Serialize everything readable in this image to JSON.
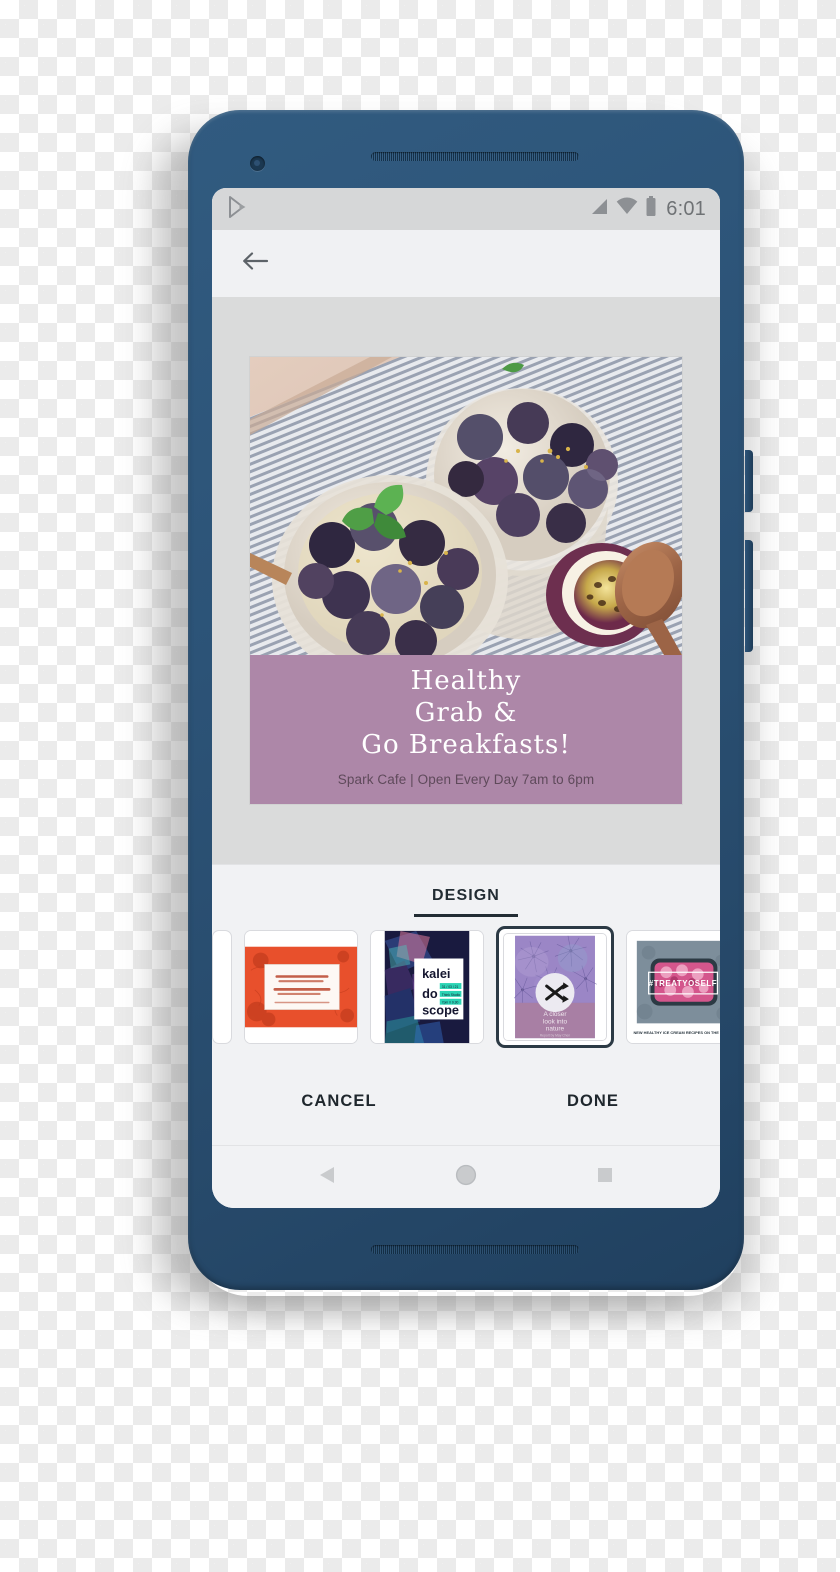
{
  "status_bar": {
    "app_icon": "play-store-icon",
    "signal_icon": "signal-bars-icon",
    "wifi_icon": "wifi-icon",
    "battery_icon": "battery-icon",
    "time": "6:01"
  },
  "app_bar": {
    "back_icon": "back-arrow-icon"
  },
  "poster": {
    "headline_lines": [
      "Healthy",
      "Grab &",
      "Go Breakfasts!"
    ],
    "headline_text": "Healthy\nGrab &\nGo Breakfasts!",
    "subtitle": "Spark Cafe | Open Every Day 7am to 6pm",
    "band_color": "#ad87a8",
    "photo_alt": "berry breakfast bowls with blueberries blackberries mint and passion fruit"
  },
  "design_panel": {
    "tab_label": "DESIGN",
    "accent_color": "#222c33",
    "thumbnails": [
      {
        "id": "thumb-partial-left",
        "title": "",
        "selected": false,
        "partial": true
      },
      {
        "id": "thumb-mum-card",
        "title": "You are the best Mum ever!",
        "line1": "You are the",
        "line2": "best Mum ever!",
        "caption": "HAPPY MOTHERS DAY! THANK YOU FOR BEING A LEGEND",
        "bg_color": "#e8502c",
        "selected": false,
        "partial": false
      },
      {
        "id": "thumb-kaleidoscope",
        "title": "kalei do scope",
        "line1": "kalei",
        "line2": "do",
        "line3": "scope",
        "bg_color": "#191a3f",
        "accent_color": "#2bd4b4",
        "selected": false,
        "partial": false
      },
      {
        "id": "thumb-nature-report",
        "title": "A closer look into nature",
        "line1": "A closer",
        "line2": "look into",
        "line3": "nature",
        "caption": "Report by May Chen",
        "bg_color": "#a87fa4",
        "overlay_icon": "shuffle-icon",
        "selected": true,
        "partial": false
      },
      {
        "id": "thumb-treat-yoself",
        "title": "#TREATYOSELF",
        "line1": "#TREATYOSELF",
        "caption": "NEW HEALTHY ICE CREAM RECIPES ON THE BLOG!",
        "bg_color": "#7d8e9b",
        "selected": false,
        "partial": false
      },
      {
        "id": "thumb-partial-right",
        "title": "",
        "selected": false,
        "partial": true
      }
    ]
  },
  "actions": {
    "cancel_label": "CANCEL",
    "done_label": "DONE"
  },
  "nav_bar": {
    "back_icon": "triangle-back-icon",
    "home_icon": "circle-home-icon",
    "recents_icon": "square-recents-icon"
  },
  "device": {
    "frame_color": "#2c5377",
    "camera_icon": "front-camera-icon",
    "speaker_icon": "speaker-grill-icon"
  }
}
